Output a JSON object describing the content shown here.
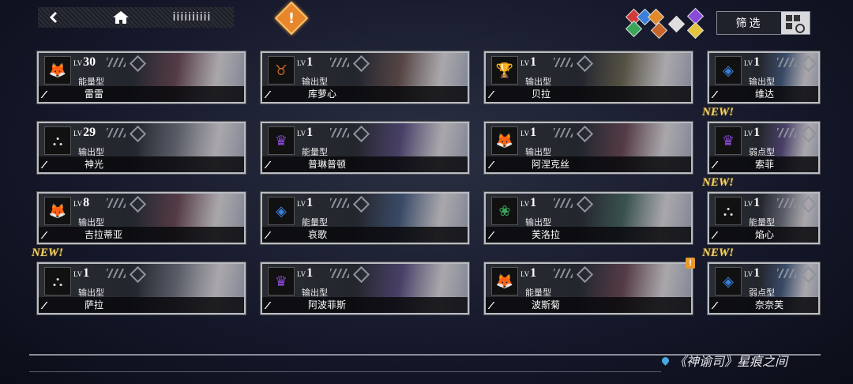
{
  "topbar": {
    "back_icon": "back-arrow-icon",
    "home_icon": "home-icon",
    "menu_label": "iiiiiiiiii"
  },
  "alert": {
    "mark": "!",
    "color": "#e7862a"
  },
  "element_filters": [
    {
      "icon": "element-red",
      "color": "#d33a3a"
    },
    {
      "icon": "element-blue",
      "color": "#3a7fd9"
    },
    {
      "icon": "element-orange",
      "color": "#e08a2a"
    },
    {
      "icon": "element-green",
      "color": "#3aa55a"
    },
    {
      "icon": "element-purple",
      "color": "#8a4ad9"
    },
    {
      "icon": "element-white",
      "color": "#dddddd"
    },
    {
      "icon": "element-yellow",
      "color": "#e3c43a"
    }
  ],
  "filter": {
    "label": "筛选"
  },
  "cards": [
    {
      "level": "30",
      "lv_prefix": "LV",
      "type": "能量型",
      "name": "雷雷",
      "stars": "⁄⁄⁄⁄⁄",
      "badge_color": "#c23232",
      "badge_glyph": "🦊",
      "new": false,
      "narrow": false
    },
    {
      "level": "1",
      "lv_prefix": "LV",
      "type": "输出型",
      "name": "库萝心",
      "stars": "⁄⁄⁄⁄",
      "badge_color": "#c6642a",
      "badge_glyph": "♉",
      "new": false,
      "narrow": false
    },
    {
      "level": "1",
      "lv_prefix": "LV",
      "type": "输出型",
      "name": "贝拉",
      "stars": "⁄⁄⁄⁄",
      "badge_color": "#c9a52a",
      "badge_glyph": "🏆",
      "new": false,
      "narrow": false
    },
    {
      "level": "1",
      "lv_prefix": "LV",
      "type": "输出型",
      "name": "维达",
      "stars": "⁄⁄⁄⁄",
      "badge_color": "#3a7fd9",
      "badge_glyph": "◈",
      "new": false,
      "narrow": true
    },
    {
      "level": "29",
      "lv_prefix": "LV",
      "type": "输出型",
      "name": "神光",
      "stars": "⁄⁄⁄⁄⁄",
      "badge_color": "#dddddd",
      "badge_glyph": "⛬",
      "new": false,
      "narrow": false
    },
    {
      "level": "1",
      "lv_prefix": "LV",
      "type": "能量型",
      "name": "普琳普顿",
      "stars": "⁄⁄⁄⁄",
      "badge_color": "#8a4ad9",
      "badge_glyph": "♛",
      "new": false,
      "narrow": false
    },
    {
      "level": "1",
      "lv_prefix": "LV",
      "type": "输出型",
      "name": "阿涅克丝",
      "stars": "⁄⁄⁄⁄",
      "badge_color": "#c23232",
      "badge_glyph": "🦊",
      "new": false,
      "narrow": false
    },
    {
      "level": "1",
      "lv_prefix": "LV",
      "type": "弱点型",
      "name": "索菲",
      "stars": "⁄⁄⁄⁄",
      "badge_color": "#8a4ad9",
      "badge_glyph": "♛",
      "new": true,
      "narrow": true
    },
    {
      "level": "8",
      "lv_prefix": "LV",
      "type": "输出型",
      "name": "吉拉蒂亚",
      "stars": "⁄⁄⁄⁄⁄",
      "badge_color": "#c23232",
      "badge_glyph": "🦊",
      "new": false,
      "narrow": false
    },
    {
      "level": "1",
      "lv_prefix": "LV",
      "type": "能量型",
      "name": "哀歌",
      "stars": "⁄⁄⁄⁄",
      "badge_color": "#3a7fd9",
      "badge_glyph": "◈",
      "new": false,
      "narrow": false
    },
    {
      "level": "1",
      "lv_prefix": "LV",
      "type": "输出型",
      "name": "芙洛拉",
      "stars": "⁄⁄⁄⁄",
      "badge_color": "#3aa55a",
      "badge_glyph": "❀",
      "new": false,
      "narrow": false
    },
    {
      "level": "1",
      "lv_prefix": "LV",
      "type": "能量型",
      "name": "焰心",
      "stars": "⁄⁄⁄⁄",
      "badge_color": "#dddddd",
      "badge_glyph": "⛬",
      "new": true,
      "narrow": true
    },
    {
      "level": "1",
      "lv_prefix": "LV",
      "type": "输出型",
      "name": "萨拉",
      "stars": "⁄⁄⁄⁄⁄",
      "badge_color": "#dddddd",
      "badge_glyph": "⛬",
      "new": true,
      "narrow": false
    },
    {
      "level": "1",
      "lv_prefix": "LV",
      "type": "输出型",
      "name": "阿波菲斯",
      "stars": "⁄⁄⁄⁄⁄",
      "badge_color": "#8a4ad9",
      "badge_glyph": "♛",
      "new": false,
      "narrow": false
    },
    {
      "level": "1",
      "lv_prefix": "LV",
      "type": "能量型",
      "name": "波斯菊",
      "stars": "⁄⁄⁄⁄",
      "badge_color": "#c23232",
      "badge_glyph": "🦊",
      "new": false,
      "narrow": false
    },
    {
      "level": "1",
      "lv_prefix": "LV",
      "type": "弱点型",
      "name": "奈奈芙",
      "stars": "⁄⁄⁄⁄",
      "badge_color": "#3a7fd9",
      "badge_glyph": "◈",
      "new": true,
      "narrow": true
    }
  ],
  "new_label": "NEW!",
  "warning_mark": "!",
  "location": {
    "icon": "location-pin-icon",
    "text": "《神谕司》星痕之间"
  }
}
